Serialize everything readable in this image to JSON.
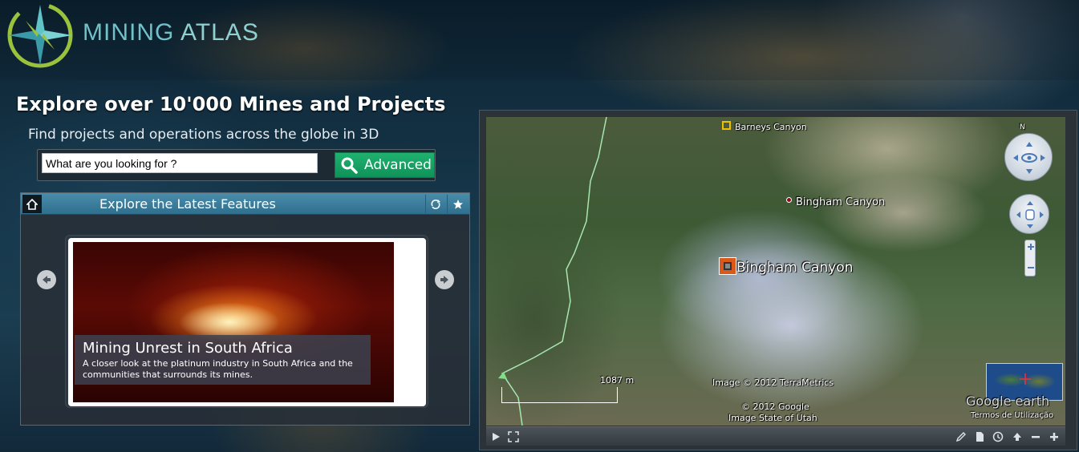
{
  "brand": {
    "name_part1": "MINING",
    "name_part2": "ATLAS"
  },
  "hero": {
    "headline": "Explore over 10'000 Mines and Projects",
    "subline": "Find projects and operations across the globe in 3D"
  },
  "search": {
    "value": "What are you looking for ?",
    "advanced_label": "Advanced"
  },
  "features": {
    "title": "Explore the Latest Features",
    "card": {
      "title": "Mining Unrest in South Africa",
      "text": "A closer look at the platinum industry in South Africa and the communities that surrounds its mines."
    }
  },
  "map": {
    "labels": {
      "barneys": "Barneys Canyon",
      "bingham_small": "Bingham Canyon",
      "bingham_big": "Bingham Canyon",
      "scale": "1087 m",
      "credit1": "Image © 2012 TerraMetrics",
      "credit2": "© 2012 Google",
      "credit3": "Image State of Utah",
      "brand": "Google earth",
      "terms": "Termos de Utilização",
      "compass": "N"
    }
  },
  "colors": {
    "accent_green": "#1fb26f",
    "header_blue": "#3b7f9e",
    "pin_orange": "#d9581a"
  }
}
